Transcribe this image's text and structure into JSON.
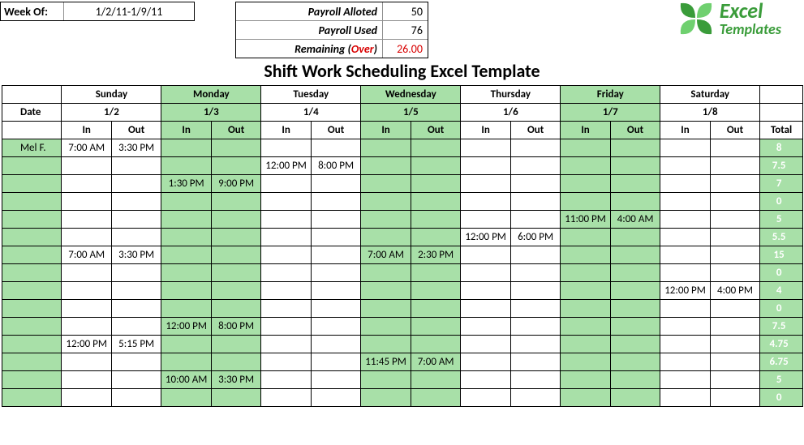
{
  "header": {
    "week_label": "Week Of:",
    "week_value": "1/2/11-1/9/11",
    "payroll": {
      "alloted_label": "Payroll Alloted",
      "alloted_value": "50",
      "used_label": "Payroll Used",
      "used_value": "76",
      "remaining_label_pre": "Remaining (",
      "remaining_label_over": "Over",
      "remaining_label_post": ")",
      "remaining_value": "26.00"
    },
    "logo": {
      "line1": "Excel",
      "line2": "Templates"
    }
  },
  "title": "Shift Work Scheduling Excel Template",
  "days": [
    {
      "name": "Sunday",
      "date": "1/2"
    },
    {
      "name": "Monday",
      "date": "1/3"
    },
    {
      "name": "Tuesday",
      "date": "1/4"
    },
    {
      "name": "Wednesday",
      "date": "1/5"
    },
    {
      "name": "Thursday",
      "date": "1/6"
    },
    {
      "name": "Friday",
      "date": "1/7"
    },
    {
      "name": "Saturday",
      "date": "1/8"
    }
  ],
  "labels": {
    "date": "Date",
    "in": "In",
    "out": "Out",
    "total": "Total"
  },
  "rows": [
    {
      "name": "Mel F.",
      "cells": [
        "7:00 AM",
        "3:30 PM",
        "",
        "",
        "",
        "",
        "",
        "",
        "",
        "",
        "",
        "",
        "",
        ""
      ],
      "total": "8"
    },
    {
      "name": "",
      "cells": [
        "",
        "",
        "",
        "",
        "12:00 PM",
        "8:00 PM",
        "",
        "",
        "",
        "",
        "",
        "",
        "",
        ""
      ],
      "total": "7.5"
    },
    {
      "name": "",
      "cells": [
        "",
        "",
        "1:30 PM",
        "9:00 PM",
        "",
        "",
        "",
        "",
        "",
        "",
        "",
        "",
        "",
        ""
      ],
      "total": "7"
    },
    {
      "name": "",
      "cells": [
        "",
        "",
        "",
        "",
        "",
        "",
        "",
        "",
        "",
        "",
        "",
        "",
        "",
        ""
      ],
      "total": "0"
    },
    {
      "name": "",
      "cells": [
        "",
        "",
        "",
        "",
        "",
        "",
        "",
        "",
        "",
        "",
        "11:00 PM",
        "4:00 AM",
        "",
        ""
      ],
      "total": "5"
    },
    {
      "name": "",
      "cells": [
        "",
        "",
        "",
        "",
        "",
        "",
        "",
        "",
        "12:00 PM",
        "6:00 PM",
        "",
        "",
        "",
        ""
      ],
      "total": "5.5"
    },
    {
      "name": "",
      "cells": [
        "7:00 AM",
        "3:30 PM",
        "",
        "",
        "",
        "",
        "7:00 AM",
        "2:30 PM",
        "",
        "",
        "",
        "",
        "",
        ""
      ],
      "total": "15"
    },
    {
      "name": "",
      "cells": [
        "",
        "",
        "",
        "",
        "",
        "",
        "",
        "",
        "",
        "",
        "",
        "",
        "",
        ""
      ],
      "total": "0"
    },
    {
      "name": "",
      "cells": [
        "",
        "",
        "",
        "",
        "",
        "",
        "",
        "",
        "",
        "",
        "",
        "",
        "12:00 PM",
        "4:00 PM"
      ],
      "total": "4"
    },
    {
      "name": "",
      "cells": [
        "",
        "",
        "",
        "",
        "",
        "",
        "",
        "",
        "",
        "",
        "",
        "",
        "",
        ""
      ],
      "total": "0"
    },
    {
      "name": "",
      "cells": [
        "",
        "",
        "12:00 PM",
        "8:00 PM",
        "",
        "",
        "",
        "",
        "",
        "",
        "",
        "",
        "",
        ""
      ],
      "total": "7.5"
    },
    {
      "name": "",
      "cells": [
        "12:00 PM",
        "5:15 PM",
        "",
        "",
        "",
        "",
        "",
        "",
        "",
        "",
        "",
        "",
        "",
        ""
      ],
      "total": "4.75"
    },
    {
      "name": "",
      "cells": [
        "",
        "",
        "",
        "",
        "",
        "",
        "11:45 PM",
        "7:00 AM",
        "",
        "",
        "",
        "",
        "",
        ""
      ],
      "total": "6.75"
    },
    {
      "name": "",
      "cells": [
        "",
        "",
        "10:00 AM",
        "3:30 PM",
        "",
        "",
        "",
        "",
        "",
        "",
        "",
        "",
        "",
        ""
      ],
      "total": "5"
    },
    {
      "name": "",
      "cells": [
        "",
        "",
        "",
        "",
        "",
        "",
        "",
        "",
        "",
        "",
        "",
        "",
        "",
        ""
      ],
      "total": "0"
    }
  ],
  "green_day_indices": [
    1,
    3,
    5
  ]
}
